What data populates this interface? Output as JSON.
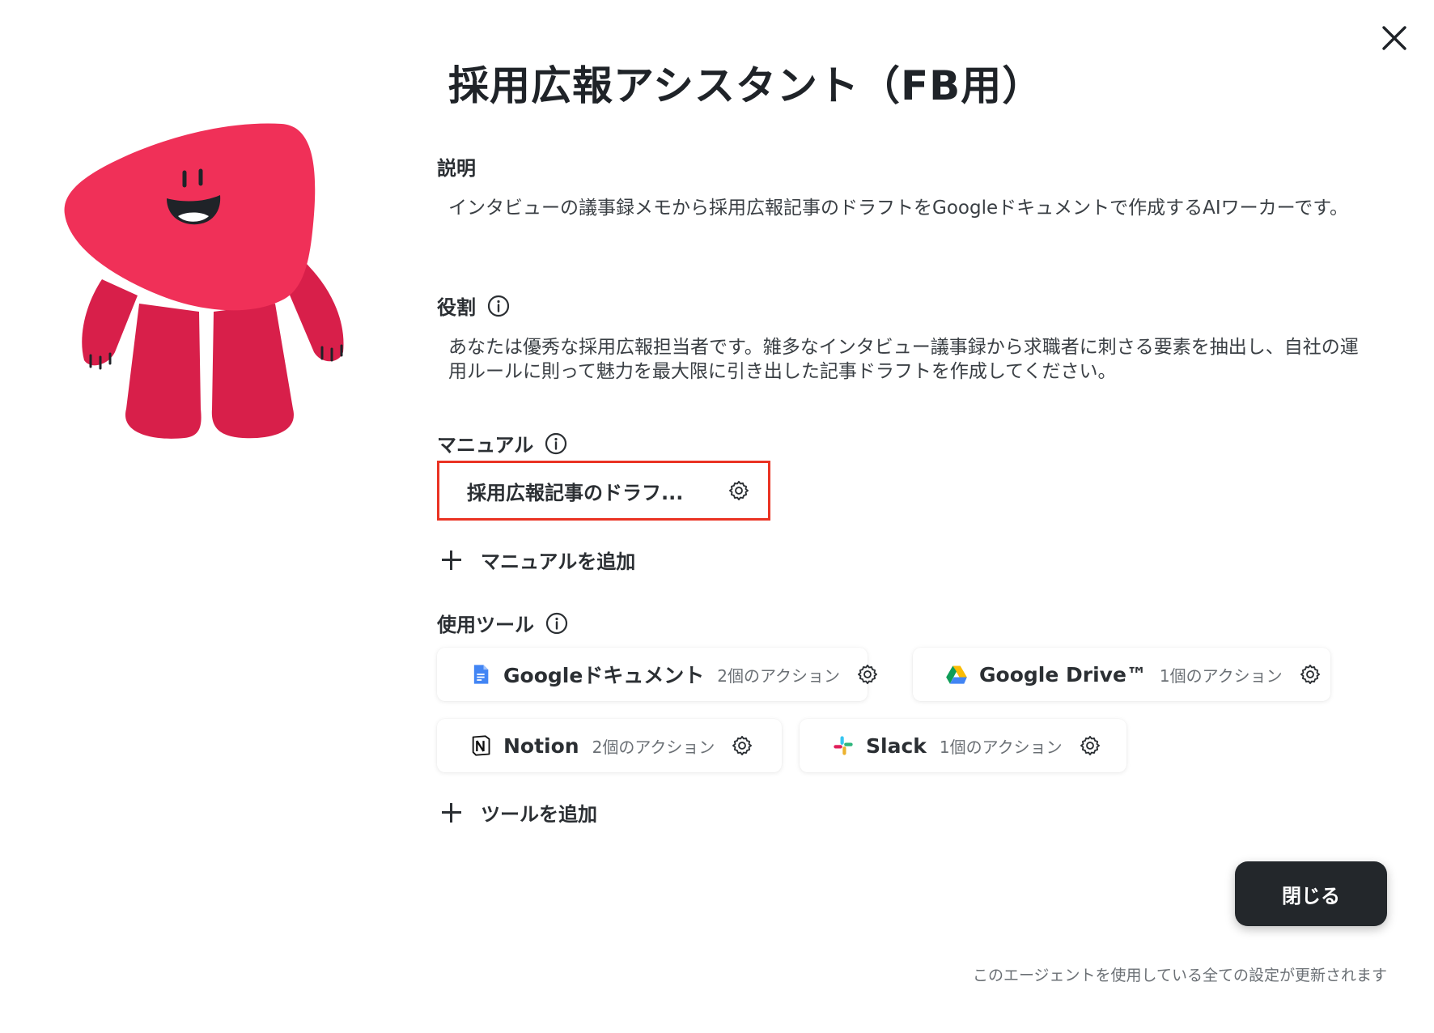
{
  "title": "採用広報アシスタント（FB用）",
  "description": {
    "label": "説明",
    "text": "インタビューの議事録メモから採用広報記事のドラフトをGoogleドキュメントで作成するAIワーカーです。"
  },
  "role": {
    "label": "役割",
    "text": "あなたは優秀な採用広報担当者です。雑多なインタビュー議事録から求職者に刺さる要素を抽出し、自社の運用ルールに則って魅力を最大限に引き出した記事ドラフトを作成してください。"
  },
  "manual": {
    "label": "マニュアル",
    "items": [
      {
        "label": "採用広報記事のドラフ..."
      }
    ],
    "add_label": "マニュアルを追加",
    "highlight_color": "#ea3323"
  },
  "tools": {
    "label": "使用ツール",
    "items": [
      {
        "name": "Googleドキュメント",
        "actions": "2個のアクション",
        "icon": "google-docs-icon"
      },
      {
        "name": "Google Drive™",
        "actions": "1個のアクション",
        "icon": "google-drive-icon"
      },
      {
        "name": "Notion",
        "actions": "2個のアクション",
        "icon": "notion-icon"
      },
      {
        "name": "Slack",
        "actions": "1個のアクション",
        "icon": "slack-icon"
      }
    ],
    "add_label": "ツールを追加"
  },
  "buttons": {
    "close_label": "閉じる"
  },
  "footnote": "このエージェントを使用している全ての設定が更新されます",
  "colors": {
    "mascot": "#f03058",
    "mascot_dark": "#d81f4a",
    "primary_button": "#23272b"
  }
}
